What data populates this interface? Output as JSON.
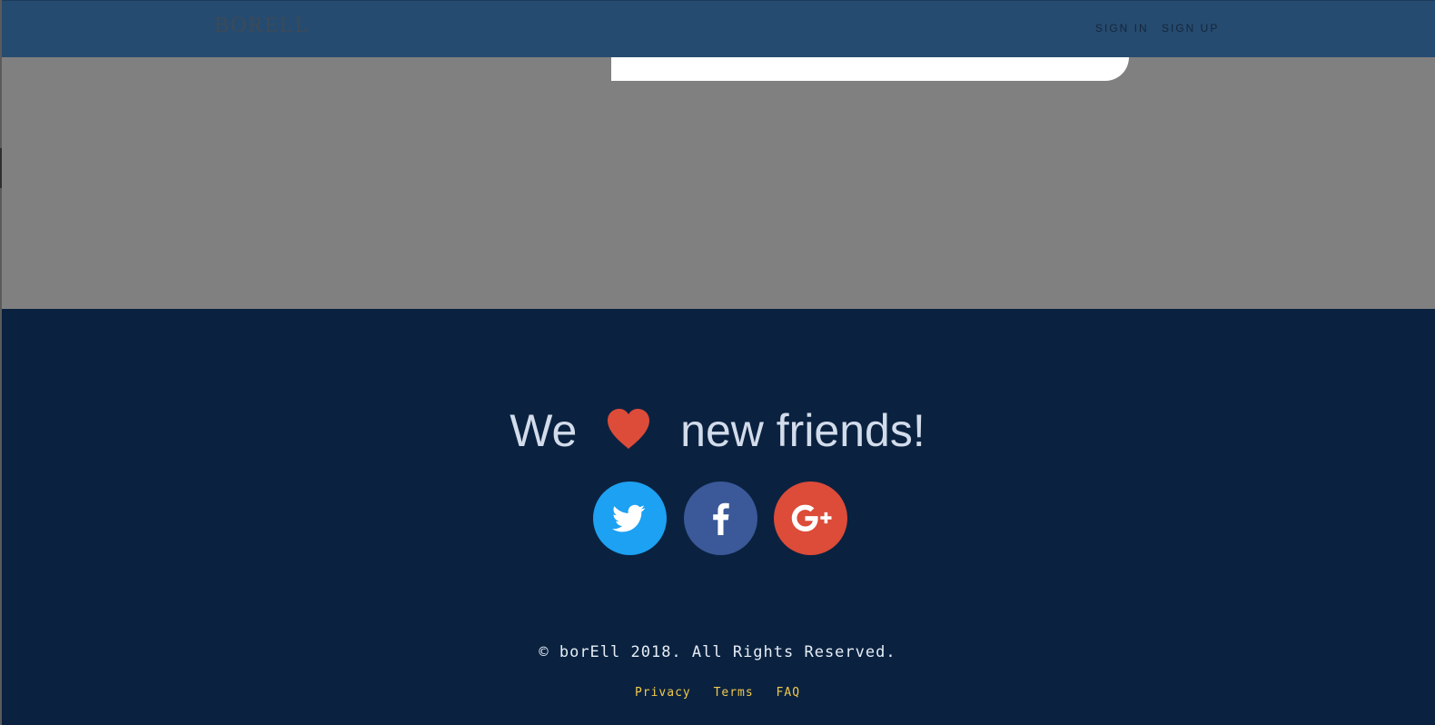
{
  "header": {
    "logo": "BORELL",
    "nav": [
      {
        "label": "SIGN IN"
      },
      {
        "label": "SIGN UP"
      }
    ]
  },
  "footer": {
    "tagline": {
      "before_heart": "We",
      "after_heart": "new friends!"
    },
    "social": [
      {
        "icon": "twitter-icon",
        "color": "#1da1f2"
      },
      {
        "icon": "facebook-icon",
        "color": "#3b5998"
      },
      {
        "icon": "google-plus-icon",
        "color": "#dd4b39"
      }
    ],
    "copyright": "© borEll 2018. All Rights Reserved.",
    "links": [
      {
        "label": "Privacy"
      },
      {
        "label": "Terms"
      },
      {
        "label": "FAQ"
      }
    ]
  },
  "colors": {
    "header_bg": "#264b70",
    "overlay_bg": "#808080",
    "footer_bg": "#0a2240",
    "heart": "#dd4b39",
    "link": "#f2c94c"
  }
}
